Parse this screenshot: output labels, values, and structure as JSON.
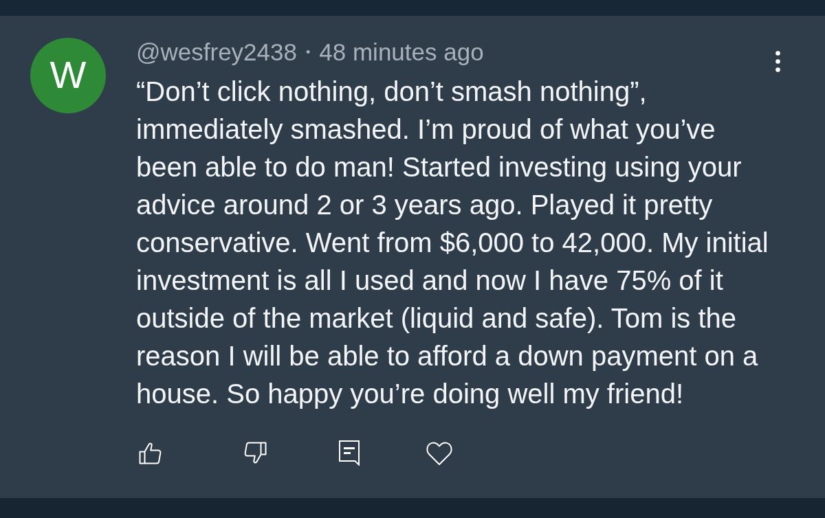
{
  "comment": {
    "avatar_letter": "W",
    "author": "@wesfrey2438",
    "separator": "•",
    "time": "48 minutes ago",
    "lines": [
      "“Don’t click nothing, don’t smash nothing”,",
      "immediately smashed. I’m proud of what you’ve",
      "been able to do man! Started investing using your",
      "advice around 2 or 3 years ago. Played it pretty",
      "conservative. Went from $6,000 to 42,000. My initial",
      "investment is all I used and now I have 75% of it",
      "outside of the market (liquid and safe). Tom is the",
      "reason I will be able to afford a down payment on a",
      "house. So happy you’re doing well my friend!"
    ]
  },
  "actions": [
    {
      "kind": "like"
    },
    {
      "kind": "dislike"
    },
    {
      "kind": "reply"
    },
    {
      "kind": "heart"
    }
  ]
}
